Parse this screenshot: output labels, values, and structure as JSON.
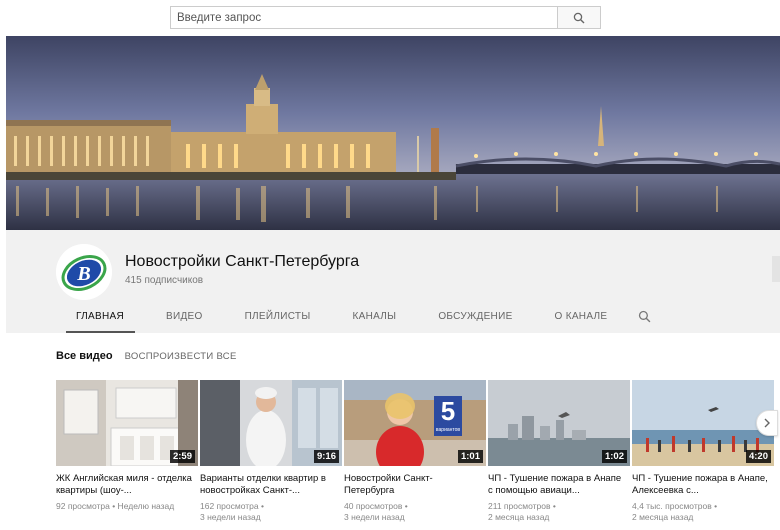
{
  "search": {
    "placeholder": "Введите запрос"
  },
  "channel": {
    "title": "Новостройки Санкт-Петербурга",
    "subscribers": "415 подписчиков",
    "avatar_letter": "B"
  },
  "tabs": [
    {
      "label": "ГЛАВНАЯ",
      "active": true
    },
    {
      "label": "ВИДЕО"
    },
    {
      "label": "ПЛЕЙЛИСТЫ"
    },
    {
      "label": "КАНАЛЫ"
    },
    {
      "label": "ОБСУЖДЕНИЕ"
    },
    {
      "label": "О КАНАЛЕ"
    }
  ],
  "section": {
    "title": "Все видео",
    "play_all": "ВОСПРОИЗВЕСТИ ВСЕ"
  },
  "videos": [
    {
      "title": "ЖК Английская миля - отделка квартиры (шоу-...",
      "duration": "2:59",
      "meta1": "92 просмотра • Неделю назад",
      "meta2": ""
    },
    {
      "title": "Варианты отделки квартир в новостройках Санкт-...",
      "duration": "9:16",
      "meta1": "162 просмотра •",
      "meta2": "3 недели назад"
    },
    {
      "title": "Новостройки Санкт-Петербурга",
      "duration": "1:01",
      "meta1": "40 просмотров •",
      "meta2": "3 недели назад",
      "badge_number": "5",
      "badge_text": "вариантов"
    },
    {
      "title": "ЧП - Тушение пожара в Анапе с помощью авиаци...",
      "duration": "1:02",
      "meta1": "211 просмотров •",
      "meta2": "2 месяца назад"
    },
    {
      "title": "ЧП - Тушение пожара в Анапе, Алексеевка с...",
      "duration": "4:20",
      "meta1": "4,4 тыс. просмотров •",
      "meta2": "2 месяца назад"
    }
  ],
  "icons": {
    "search": "search-icon",
    "next": "chevron-right-icon"
  }
}
